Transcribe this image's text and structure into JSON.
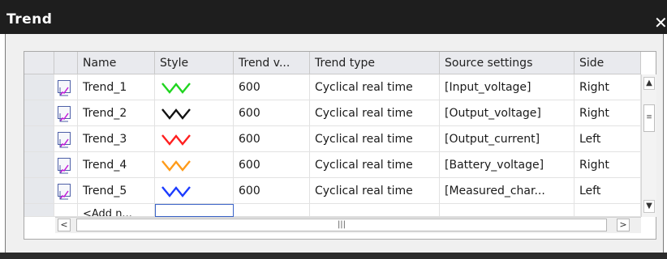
{
  "window": {
    "title": "Trend",
    "close_icon": "close-icon"
  },
  "table": {
    "columns": [
      "Name",
      "Style",
      "Trend v...",
      "Trend type",
      "Source settings",
      "Side"
    ],
    "rows": [
      {
        "name": "Trend_1",
        "style_color": "#1fd51f",
        "trend_value": "600",
        "trend_type": "Cyclical real time",
        "source": "[Input_voltage]",
        "side": "Right"
      },
      {
        "name": "Trend_2",
        "style_color": "#111111",
        "trend_value": "600",
        "trend_type": "Cyclical real time",
        "source": "[Output_voltage]",
        "side": "Right"
      },
      {
        "name": "Trend_3",
        "style_color": "#ff1f1f",
        "trend_value": "600",
        "trend_type": "Cyclical real time",
        "source": "[Output_current]",
        "side": "Left"
      },
      {
        "name": "Trend_4",
        "style_color": "#ff9b19",
        "trend_value": "600",
        "trend_type": "Cyclical real time",
        "source": "[Battery_voltage]",
        "side": "Right"
      },
      {
        "name": "Trend_5",
        "style_color": "#1b3bff",
        "trend_value": "600",
        "trend_type": "Cyclical real time",
        "source": "[Measured_char...",
        "side": "Left"
      }
    ],
    "add_row_label": "<Add n..."
  },
  "scrollbar": {
    "up": "▲",
    "down": "▼",
    "left": "<",
    "right": ">",
    "grip_vertical": "≡",
    "grip_horizontal": "|||"
  }
}
